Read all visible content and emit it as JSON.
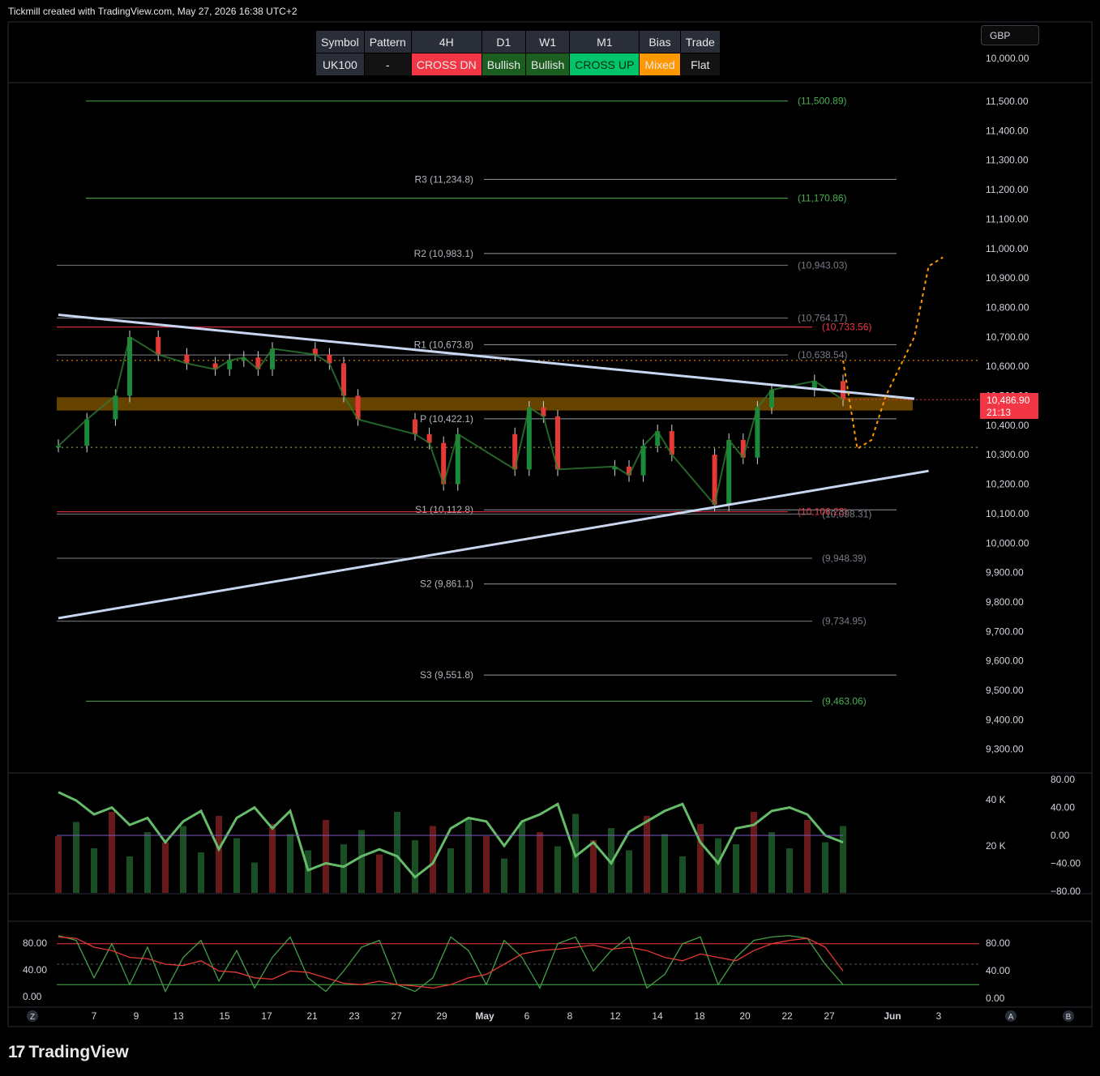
{
  "header": {
    "attribution": "Tickmill created with TradingView.com, May 27, 2026 16:38 UTC+2"
  },
  "table": {
    "headers": [
      "Symbol",
      "Pattern",
      "4H",
      "D1",
      "W1",
      "M1",
      "Bias",
      "Trade"
    ],
    "values": [
      "UK100",
      "-",
      "CROSS DN",
      "Bullish",
      "Bullish",
      "CROSS UP",
      "Mixed",
      "Flat"
    ],
    "value_colors": [
      "#2a2e39",
      "#131313",
      "#f23645",
      "#1b5e20",
      "#1b5e20",
      "#00c46a",
      "#ff9800",
      "#131313"
    ]
  },
  "currency": "GBP",
  "last_price": {
    "value": "10,486.90",
    "countdown": "21:13"
  },
  "price_axis_labels": [
    "11,500.00",
    "11,400.00",
    "11,300.00",
    "11,200.00",
    "11,100.00",
    "11,000.00",
    "10,900.00",
    "10,800.00",
    "10,700.00",
    "10,600.00",
    "10,500.00",
    "10,400.00",
    "10,300.00",
    "10,200.00",
    "10,100.00",
    "10,000.00",
    "9,900.00",
    "9,800.00",
    "9,700.00",
    "9,600.00",
    "9,500.00",
    "9,400.00",
    "9,300.00"
  ],
  "top_axis_label": "10,000.00",
  "volume_axis_labels": [
    "40 K",
    "20 K"
  ],
  "rsi_axis_labels": [
    "80.00",
    "40.00",
    "0.00",
    "−40.00",
    "−80.00"
  ],
  "stoch_axis_labels": [
    "80.00",
    "40.00",
    "0.00"
  ],
  "x_axis_labels": [
    "7",
    "9",
    "13",
    "15",
    "17",
    "21",
    "23",
    "27",
    "29",
    "May",
    "6",
    "8",
    "12",
    "14",
    "18",
    "20",
    "22",
    "27",
    "Jun",
    "3"
  ],
  "axis_corner_labels": [
    "Z",
    "A",
    "B"
  ],
  "footer": {
    "brand": "TradingView",
    "mark": "17"
  },
  "chart_data": [
    {
      "type": "candlestick",
      "symbol": "UK100",
      "currency": "GBP",
      "ylim": [
        9250,
        11560
      ],
      "x_ticks": [
        "7",
        "9",
        "13",
        "15",
        "17",
        "21",
        "23",
        "27",
        "29",
        "May",
        "6",
        "8",
        "12",
        "14",
        "18",
        "20",
        "22",
        "27",
        "Jun",
        "3"
      ],
      "price_path": [
        [
          "Apr 2",
          10330
        ],
        [
          "Apr 4",
          10420
        ],
        [
          "Apr 6",
          10500
        ],
        [
          "Apr 7",
          10700
        ],
        [
          "Apr 9",
          10640
        ],
        [
          "Apr 11",
          10610
        ],
        [
          "Apr 13",
          10590
        ],
        [
          "Apr 14",
          10620
        ],
        [
          "Apr 15",
          10630
        ],
        [
          "Apr 16",
          10590
        ],
        [
          "Apr 17",
          10660
        ],
        [
          "Apr 20",
          10640
        ],
        [
          "Apr 21",
          10610
        ],
        [
          "Apr 22",
          10500
        ],
        [
          "Apr 23",
          10420
        ],
        [
          "Apr 27",
          10370
        ],
        [
          "Apr 28",
          10340
        ],
        [
          "Apr 29",
          10200
        ],
        [
          "Apr 30",
          10370
        ],
        [
          "May 4",
          10250
        ],
        [
          "May 5",
          10460
        ],
        [
          "May 6",
          10430
        ],
        [
          "May 7",
          10250
        ],
        [
          "May 11",
          10260
        ],
        [
          "May 12",
          10230
        ],
        [
          "May 13",
          10330
        ],
        [
          "May 14",
          10380
        ],
        [
          "May 15",
          10300
        ],
        [
          "May 18",
          10130
        ],
        [
          "May 19",
          10350
        ],
        [
          "May 20",
          10290
        ],
        [
          "May 21",
          10460
        ],
        [
          "May 22",
          10520
        ],
        [
          "May 25",
          10550
        ],
        [
          "May 27",
          10486.9
        ]
      ],
      "last_price": 10486.9,
      "pivot_levels": [
        {
          "label": "R3 (11,234.8)",
          "value": 11234.8
        },
        {
          "label": "R2 (10,983.1)",
          "value": 10983.1
        },
        {
          "label": "R1 (10,673.8)",
          "value": 10673.8
        },
        {
          "label": "P (10,422.1)",
          "value": 10422.1
        },
        {
          "label": "S1 (10,112.8)",
          "value": 10112.8
        },
        {
          "label": "S2 (9,861.1)",
          "value": 9861.1
        },
        {
          "label": "S3 (9,551.8)",
          "value": 9551.8
        }
      ],
      "level_labels": [
        {
          "label": "(11,500.89)",
          "value": 11500.89,
          "color": "#4caf50"
        },
        {
          "label": "(11,170.86)",
          "value": 11170.86,
          "color": "#4caf50"
        },
        {
          "label": "(10,943.03)",
          "value": 10943.03,
          "color": "#787b86"
        },
        {
          "label": "(10,764.17)",
          "value": 10764.17,
          "color": "#787b86"
        },
        {
          "label": "(10,733.56)",
          "value": 10733.56,
          "color": "#f23645"
        },
        {
          "label": "(10,638.54)",
          "value": 10638.54,
          "color": "#787b86"
        },
        {
          "label": "(10,106.23)",
          "value": 10106.23,
          "color": "#f23645"
        },
        {
          "label": "(10,098.31)",
          "value": 10098.31,
          "color": "#787b86"
        },
        {
          "label": "(9,948.39)",
          "value": 9948.39,
          "color": "#787b86"
        },
        {
          "label": "(9,734.95)",
          "value": 9734.95,
          "color": "#787b86"
        },
        {
          "label": "(9,463.06)",
          "value": 9463.06,
          "color": "#4caf50"
        }
      ],
      "resistance_zone": [
        10450,
        10495
      ],
      "descending_trendline": [
        [
          "Apr 2",
          10775
        ],
        [
          "Jun 1",
          10490
        ]
      ],
      "ascending_trendline": [
        [
          "Apr 2",
          9745
        ],
        [
          "Jun 2",
          10245
        ]
      ],
      "projection_path": [
        [
          "May 27",
          10620
        ],
        [
          "May 28",
          10320
        ],
        [
          "May 29",
          10350
        ],
        [
          "May 30",
          10500
        ],
        [
          "Jun 1",
          10700
        ],
        [
          "Jun 2",
          10940
        ],
        [
          "Jun 3",
          10970
        ]
      ]
    },
    {
      "type": "bar+line",
      "name": "volume + oscillator",
      "y_axis": [
        "80.00",
        "40.00",
        "0.00",
        "−40.00",
        "−80.00"
      ],
      "volume_axis": [
        "40 K",
        "20 K"
      ],
      "oscillator_path": [
        62,
        50,
        30,
        40,
        15,
        25,
        -10,
        20,
        35,
        -20,
        25,
        40,
        10,
        35,
        -50,
        -40,
        -45,
        -30,
        -20,
        -30,
        -60,
        -40,
        10,
        25,
        20,
        -15,
        20,
        30,
        45,
        -30,
        -10,
        -40,
        5,
        20,
        35,
        45,
        -10,
        -40,
        10,
        15,
        35,
        40,
        30,
        0,
        -10
      ],
      "volume_heights": [
        28,
        35,
        22,
        40,
        18,
        30,
        25,
        33,
        20,
        38,
        27,
        15,
        34,
        29,
        21,
        36,
        24,
        31,
        19,
        40,
        26,
        33,
        22,
        37,
        28,
        17,
        35,
        30,
        23,
        39,
        26,
        32,
        21,
        38,
        29,
        18,
        34,
        27,
        24,
        40,
        30,
        22,
        36,
        25,
        33
      ]
    },
    {
      "type": "line",
      "name": "stochastic",
      "y_axis": [
        "80.00",
        "40.00",
        "0.00"
      ],
      "bands": [
        80,
        20
      ],
      "k": [
        92,
        85,
        30,
        80,
        20,
        75,
        10,
        60,
        85,
        25,
        70,
        15,
        60,
        90,
        30,
        10,
        40,
        75,
        85,
        20,
        10,
        30,
        90,
        70,
        20,
        85,
        60,
        15,
        80,
        90,
        40,
        70,
        90,
        15,
        35,
        80,
        90,
        20,
        60,
        85,
        90,
        92,
        88,
        50,
        20
      ],
      "d": [
        90,
        88,
        75,
        70,
        60,
        58,
        50,
        48,
        55,
        40,
        38,
        30,
        28,
        40,
        38,
        30,
        22,
        20,
        25,
        20,
        18,
        15,
        20,
        30,
        35,
        50,
        65,
        70,
        72,
        75,
        78,
        72,
        75,
        70,
        60,
        55,
        65,
        60,
        55,
        70,
        80,
        85,
        88,
        75,
        40
      ]
    }
  ]
}
